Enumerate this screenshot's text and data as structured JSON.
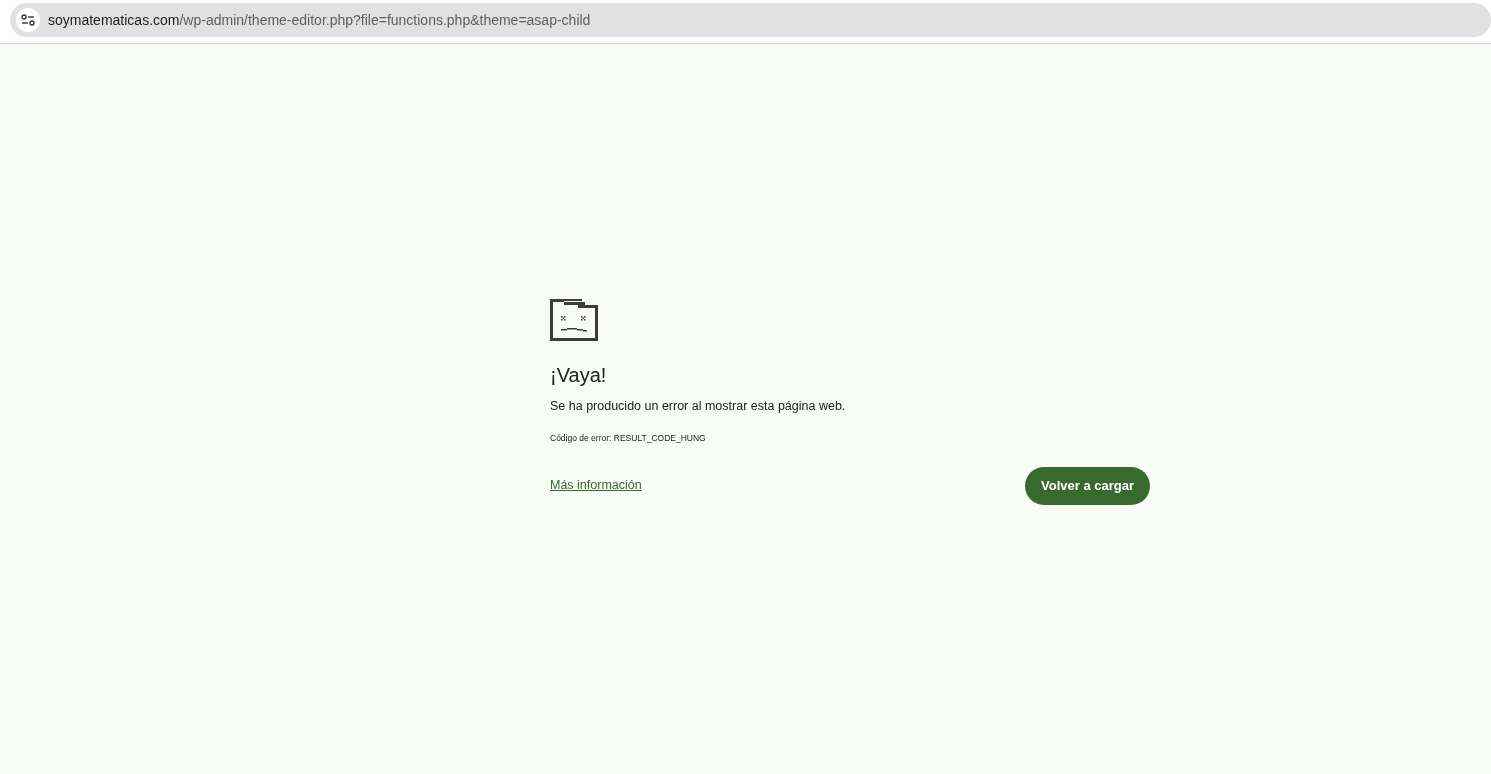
{
  "address_bar": {
    "host": "soymatematicas.com",
    "path": "/wp-admin/theme-editor.php?file=functions.php&theme=asap-child"
  },
  "error": {
    "title": "¡Vaya!",
    "message": "Se ha producido un error al mostrar esta página web.",
    "code": "Código de error: RESULT_CODE_HUNG",
    "link": "Más información",
    "button": "Volver a cargar"
  }
}
